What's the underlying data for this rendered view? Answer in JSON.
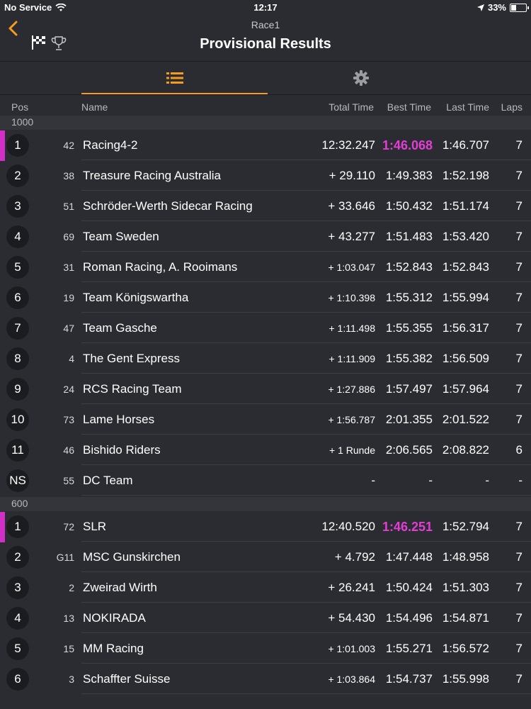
{
  "status": {
    "carrier": "No Service",
    "time": "12:17",
    "battery": "33%",
    "battery_level": 0.33
  },
  "header": {
    "race": "Race1",
    "title": "Provisional Results"
  },
  "icons": {
    "back": "chevron-left-icon",
    "flag": "checkered-flag-icon",
    "trophy": "trophy-icon",
    "list": "list-icon",
    "settings": "gear-icon"
  },
  "colors": {
    "accent": "#f39c1f",
    "fastest": "#e23ed6",
    "leader_marker": "#d22fc7"
  },
  "columns": {
    "pos": "Pos",
    "name": "Name",
    "total": "Total Time",
    "best": "Best Time",
    "last": "Last Time",
    "laps": "Laps"
  },
  "groups": [
    {
      "label": "1000",
      "rows": [
        {
          "pos": "1",
          "num": "42",
          "name": "Racing4-2",
          "total": "12:32.247",
          "best": "1:46.068",
          "last": "1:46.707",
          "laps": "7"
        },
        {
          "pos": "2",
          "num": "38",
          "name": "Treasure Racing Australia",
          "total": "+ 29.110",
          "best": "1:49.383",
          "last": "1:52.198",
          "laps": "7"
        },
        {
          "pos": "3",
          "num": "51",
          "name": "Schröder-Werth Sidecar Racing",
          "total": "+ 33.646",
          "best": "1:50.432",
          "last": "1:51.174",
          "laps": "7"
        },
        {
          "pos": "4",
          "num": "69",
          "name": "Team Sweden",
          "total": "+ 43.277",
          "best": "1:51.483",
          "last": "1:53.420",
          "laps": "7"
        },
        {
          "pos": "5",
          "num": "31",
          "name": "Roman Racing, A. Rooimans",
          "total": "+ 1:03.047",
          "best": "1:52.843",
          "last": "1:52.843",
          "laps": "7"
        },
        {
          "pos": "6",
          "num": "19",
          "name": "Team Königswartha",
          "total": "+ 1:10.398",
          "best": "1:55.312",
          "last": "1:55.994",
          "laps": "7"
        },
        {
          "pos": "7",
          "num": "47",
          "name": "Team Gasche",
          "total": "+ 1:11.498",
          "best": "1:55.355",
          "last": "1:56.317",
          "laps": "7"
        },
        {
          "pos": "8",
          "num": "4",
          "name": "The Gent Express",
          "total": "+ 1:11.909",
          "best": "1:55.382",
          "last": "1:56.509",
          "laps": "7"
        },
        {
          "pos": "9",
          "num": "24",
          "name": "RCS Racing Team",
          "total": "+ 1:27.886",
          "best": "1:57.497",
          "last": "1:57.964",
          "laps": "7"
        },
        {
          "pos": "10",
          "num": "73",
          "name": "Lame Horses",
          "total": "+ 1:56.787",
          "best": "2:01.355",
          "last": "2:01.522",
          "laps": "7"
        },
        {
          "pos": "11",
          "num": "46",
          "name": "Bishido Riders",
          "total": "+ 1 Runde",
          "best": "2:06.565",
          "last": "2:08.822",
          "laps": "6"
        },
        {
          "pos": "NS",
          "num": "55",
          "name": "DC Team",
          "total": "-",
          "best": "-",
          "last": "-",
          "laps": "-"
        }
      ]
    },
    {
      "label": "600",
      "rows": [
        {
          "pos": "1",
          "num": "72",
          "name": "SLR",
          "total": "12:40.520",
          "best": "1:46.251",
          "last": "1:52.794",
          "laps": "7"
        },
        {
          "pos": "2",
          "num": "G11",
          "name": "MSC Gunskirchen",
          "total": "+ 4.792",
          "best": "1:47.448",
          "last": "1:48.958",
          "laps": "7"
        },
        {
          "pos": "3",
          "num": "2",
          "name": "Zweirad Wirth",
          "total": "+ 26.241",
          "best": "1:50.424",
          "last": "1:51.303",
          "laps": "7"
        },
        {
          "pos": "4",
          "num": "13",
          "name": "NOKIRADA",
          "total": "+ 54.430",
          "best": "1:54.496",
          "last": "1:54.871",
          "laps": "7"
        },
        {
          "pos": "5",
          "num": "15",
          "name": "MM Racing",
          "total": "+ 1:01.003",
          "best": "1:55.271",
          "last": "1:56.572",
          "laps": "7"
        },
        {
          "pos": "6",
          "num": "3",
          "name": "Schaffter Suisse",
          "total": "+ 1:03.864",
          "best": "1:54.737",
          "last": "1:55.998",
          "laps": "7"
        }
      ]
    }
  ]
}
